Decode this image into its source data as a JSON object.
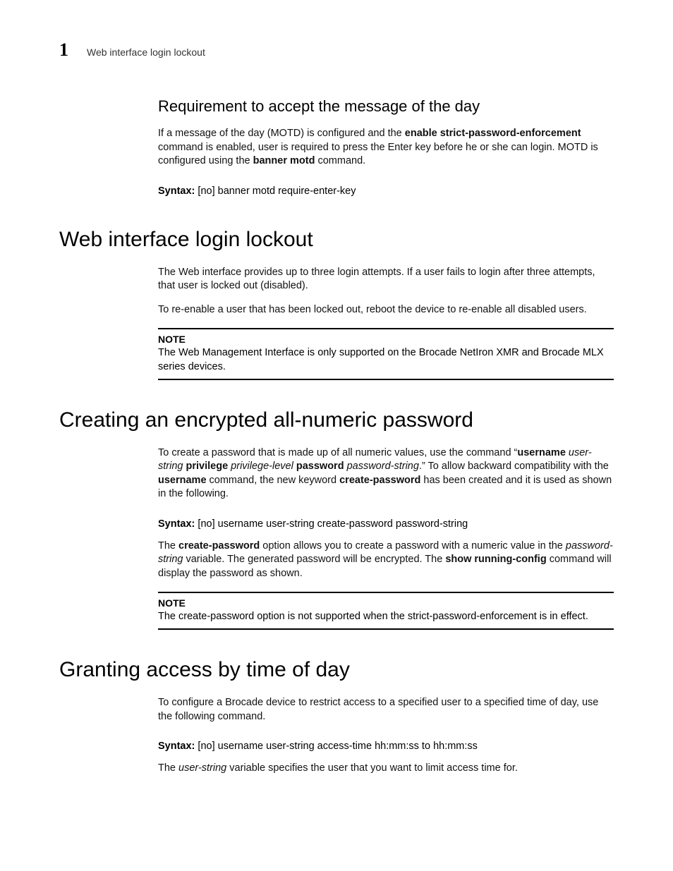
{
  "header": {
    "chapter_number": "1",
    "running_title": "Web interface login lockout"
  },
  "sections": {
    "motd": {
      "heading": "Requirement to accept the message of the day",
      "p1_a": "If a message of the day (MOTD) is configured and the ",
      "p1_b": "enable strict-password-enforcement",
      "p1_c": " command is enabled, user is required to press the Enter key before he or she can login. MOTD is configured using the ",
      "p1_d": "banner motd",
      "p1_e": " command.",
      "syntax_label": "Syntax:",
      "syntax_text": " [no] banner motd require-enter-key"
    },
    "lockout": {
      "heading": "Web interface login lockout",
      "p1": "The Web interface provides up to three login attempts. If a user fails to login after three attempts, that user is locked out (disabled).",
      "p2": "To re-enable a user that has been locked out, reboot the device to re-enable all disabled users.",
      "note_label": "NOTE",
      "note_text": "The Web Management Interface is only supported on the Brocade NetIron XMR and Brocade MLX series devices."
    },
    "numeric": {
      "heading": "Creating an encrypted all-numeric password",
      "p1_a": "To create a password that is made up of all numeric values, use the command “",
      "p1_b": "username",
      "p1_c": " ",
      "p1_d": "user-string",
      "p1_e": " ",
      "p1_f": "privilege",
      "p1_g": " ",
      "p1_h": "privilege-level",
      "p1_i": " ",
      "p1_j": "password",
      "p1_k": " ",
      "p1_l": "password-string",
      "p1_m": ".” To allow backward compatibility with the ",
      "p1_n": "username",
      "p1_o": " command, the new keyword ",
      "p1_p": "create-password",
      "p1_q": " has been created and it is used as shown in the following.",
      "syntax_label": "Syntax:",
      "syn_a": " [no] username ",
      "syn_b": "user-string",
      "syn_c": " create-password ",
      "syn_d": "password-string",
      "p2_a": "The ",
      "p2_b": "create-password",
      "p2_c": " option allows you to create a password with a numeric value in the ",
      "p2_d": "password-string",
      "p2_e": " variable. The generated password will be encrypted. The ",
      "p2_f": "show running-config",
      "p2_g": " command will display the password as shown.",
      "note_label": "NOTE",
      "note_a": "The ",
      "note_b": "create-password",
      "note_c": " option is not supported when the ",
      "note_d": "strict-password-enforcement",
      "note_e": " is in effect."
    },
    "timeofday": {
      "heading": "Granting access by time of day",
      "p1": "To configure a Brocade device to restrict access to a specified user to a specified time of day, use the following command.",
      "syntax_label": "Syntax:",
      "syn_a": " [no] username ",
      "syn_b": "user-string",
      "syn_c": " access-time ",
      "syn_d": "hh:mm:ss",
      "syn_e": " to ",
      "syn_f": "hh:mm:ss",
      "p2_a": "The ",
      "p2_b": "user-string",
      "p2_c": " variable specifies the user that you want to limit access time for."
    }
  }
}
